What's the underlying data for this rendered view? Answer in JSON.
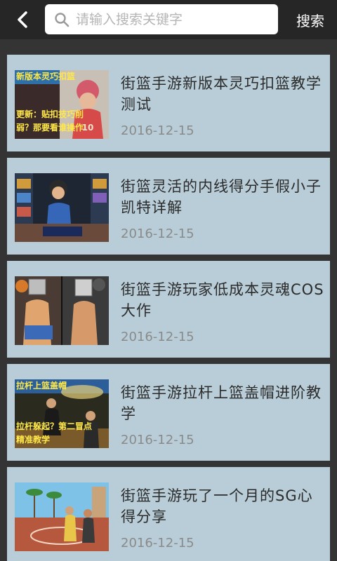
{
  "header": {
    "search_placeholder": "请输入搜索关键字",
    "search_button": "搜索"
  },
  "articles": [
    {
      "title": "街篮手游新版本灵巧扣篮教学测试",
      "date": "2016-12-15",
      "thumb_caption_top": "新版本灵巧扣篮",
      "thumb_caption_bottom": "更新：贴扣技巧削弱？那要看谁操作"
    },
    {
      "title": "街篮灵活的内线得分手假小子凯特详解",
      "date": "2016-12-15"
    },
    {
      "title": "街篮手游玩家低成本灵魂COS大作",
      "date": "2016-12-15"
    },
    {
      "title": "街篮手游拉杆上篮盖帽进阶教学",
      "date": "2016-12-15",
      "thumb_caption_top": "拉杆上篮盖帽",
      "thumb_caption_bottom": "拉杆躲起？第二冒点精准教学"
    },
    {
      "title": "街篮手游玩了一个月的SG心得分享",
      "date": "2016-12-15"
    }
  ],
  "colors": {
    "card_bg": "#b8cdd7",
    "list_bg": "#343434",
    "topbar_bg": "#262626"
  },
  "icons": {
    "back": "chevron-left-icon",
    "search": "search-icon"
  }
}
